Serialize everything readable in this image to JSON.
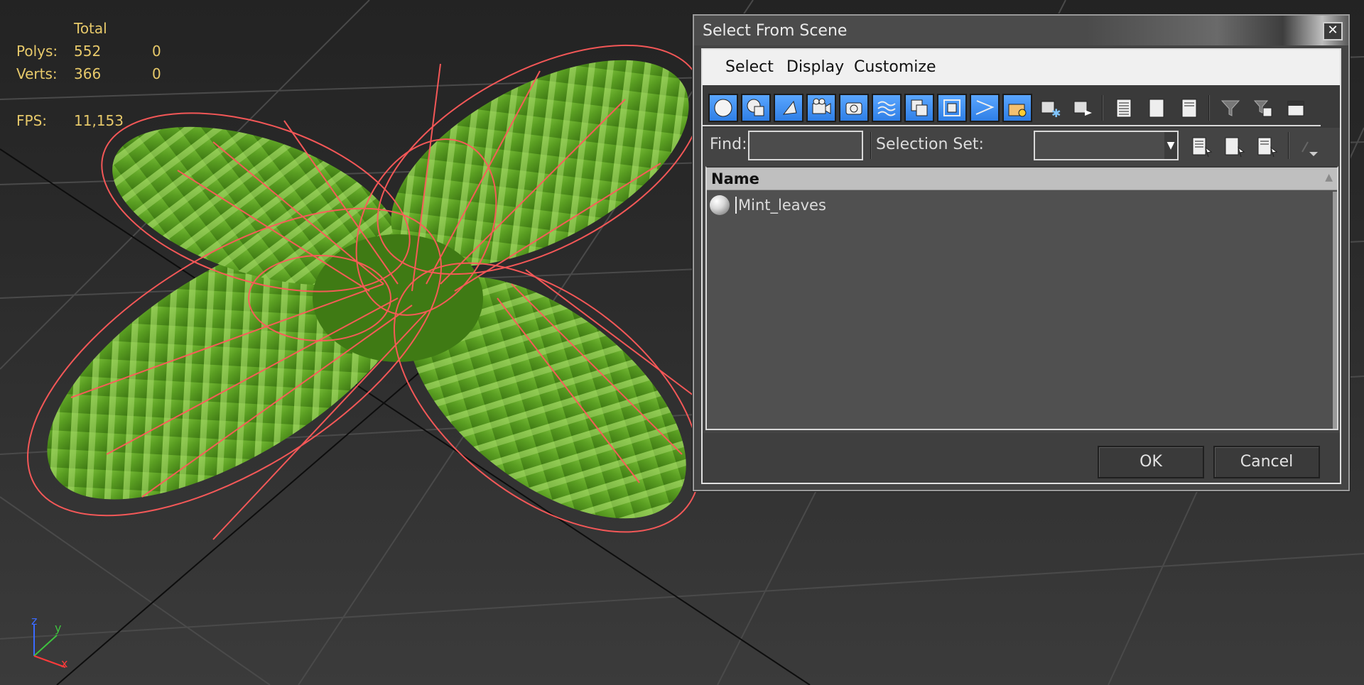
{
  "viewport": {
    "stats": {
      "header": "Total",
      "polys_label": "Polys:",
      "polys_total": "552",
      "polys_selected": "0",
      "verts_label": "Verts:",
      "verts_total": "366",
      "verts_selected": "0",
      "fps_label": "FPS:",
      "fps_value": "11,153"
    },
    "axis": {
      "x": "x",
      "y": "y",
      "z": "z"
    },
    "wireframe_color": "#ff5a5a",
    "leaf_color": "#5fa024"
  },
  "dialog": {
    "title": "Select From Scene",
    "close_glyph": "✕",
    "menu": [
      "Select",
      "Display",
      "Customize"
    ],
    "toolbar_icons": [
      "display-geometry-icon",
      "display-shapes-icon",
      "display-lights-icon",
      "display-cameras-icon",
      "display-helpers-icon",
      "display-spacewarps-icon",
      "display-groups-icon",
      "display-xrefs-icon",
      "display-bones-icon",
      "display-containers-icon",
      "display-frozen-icon",
      "display-hidden-icon",
      "display-all-icon",
      "display-none-icon",
      "invert-display-icon",
      "filter-icon",
      "filter-options-icon",
      "sync-selection-icon"
    ],
    "find_label": "Find:",
    "find_value": "",
    "selection_set_label": "Selection Set:",
    "selection_set_value": "",
    "list": {
      "column_name": "Name",
      "rows": [
        {
          "name": "Mint_leaves",
          "icon": "geometry-sphere-icon"
        }
      ]
    },
    "ok_label": "OK",
    "cancel_label": "Cancel",
    "accent": "#3f8cf0"
  }
}
